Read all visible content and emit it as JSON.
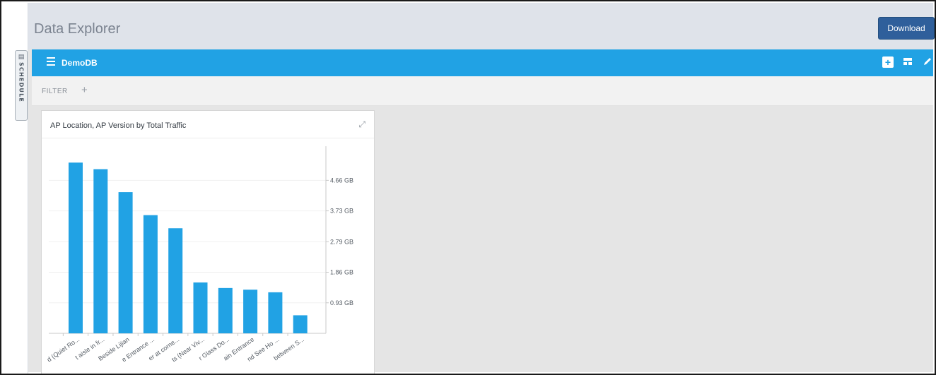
{
  "header": {
    "title": "Data Explorer",
    "download_label": "Download"
  },
  "sidebar": {
    "schedule_label": "SCHEDULE",
    "schedule_icon": "calendar-icon"
  },
  "dbbar": {
    "name": "DemoDB",
    "icons": [
      "menu-icon",
      "add-widget-icon",
      "layout-icon",
      "edit-icon"
    ]
  },
  "filter": {
    "label": "FILTER",
    "add_label": "+"
  },
  "colors": {
    "accent": "#21a2e4",
    "download": "#2f5f9b",
    "bar": "#21a2e4",
    "header_bg": "#dfe3ea",
    "canvas_bg": "#e5e5e5"
  },
  "chart": {
    "title": "AP Location, AP Version by Total Traffic",
    "expand_icon": "expand-icon"
  },
  "chart_data": {
    "type": "bar",
    "title": "AP Location, AP Version by Total Traffic",
    "categories": [
      "d (Quiet Ro...",
      "t aisle in fr...",
      "Beside Lijian",
      "e Entrance ...",
      "er at corne...",
      "ts (Near Viv...",
      "r Glass Do...",
      "ain Entrance",
      "nd See Ho ...",
      "between S..."
    ],
    "values": [
      5.2,
      5.0,
      4.3,
      3.6,
      3.2,
      1.55,
      1.38,
      1.33,
      1.25,
      0.55
    ],
    "ytick_values": [
      0.93,
      1.86,
      2.79,
      3.73,
      4.66
    ],
    "ytick_labels": [
      "0.93 GB",
      "1.86 GB",
      "2.79 GB",
      "3.73 GB",
      "4.66 GB"
    ],
    "ylim": [
      0,
      5.7
    ],
    "y_axis_side": "right",
    "grid": true,
    "legend": "none"
  }
}
